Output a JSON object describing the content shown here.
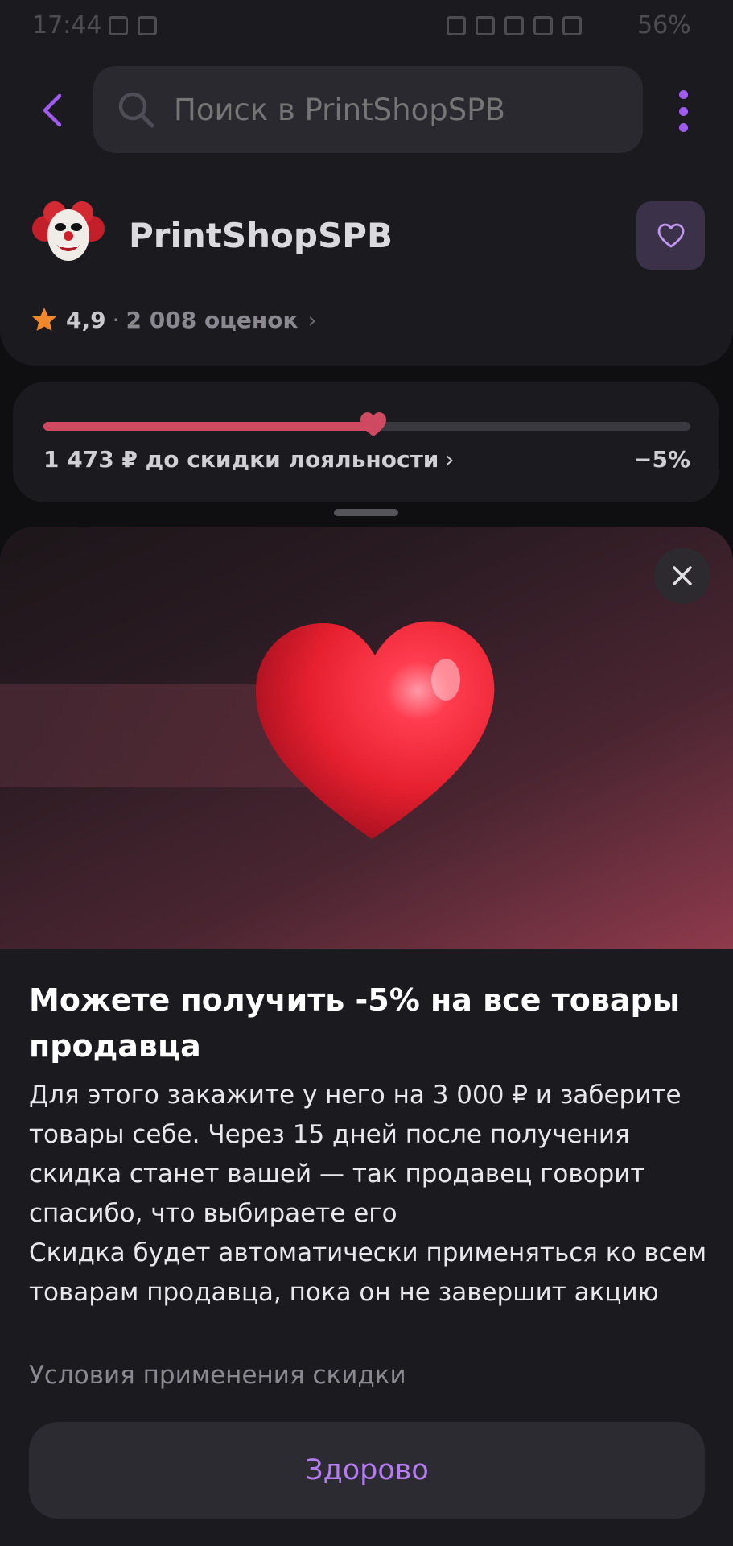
{
  "status_bar": {
    "time": "17:44",
    "battery": "56%"
  },
  "header": {
    "search_placeholder": "Поиск в PrintShopSPB",
    "shop_name": "PrintShopSPB",
    "rating_value": "4,9",
    "rating_count": "2 008 оценок"
  },
  "loyalty": {
    "text": "1 473 ₽ до скидки лояльности",
    "discount": "−5%",
    "progress_fraction": 0.51
  },
  "sheet": {
    "title": "Можете получить -5% на все товары продавца",
    "paragraph_1": "Для этого закажите у него на 3 000 ₽ и заберите товары себе. Через 15 дней после получения скидка станет вашей — так продавец говорит спасибо, что выбираете его",
    "paragraph_2": "Скидка будет автоматически применяться ко всем товарам продавца, пока он не завершит акцию",
    "conditions_link": "Условия применения скидки",
    "button_label": "Здорово"
  },
  "colors": {
    "accent": "#a05cf0",
    "progress": "#cf4a60",
    "button_text": "#b47bf2"
  },
  "icons": {
    "back": "chevron-left-icon",
    "search": "search-icon",
    "more": "more-vertical-icon",
    "favorite": "heart-outline-icon",
    "star": "star-icon",
    "close": "close-icon"
  }
}
